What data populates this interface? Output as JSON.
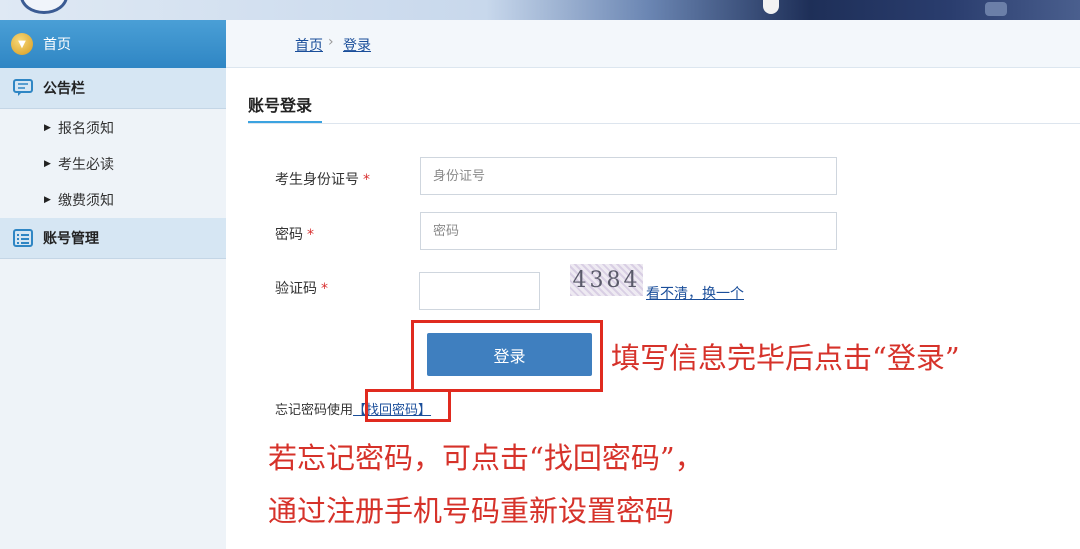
{
  "sidebar": {
    "home_label": "首页",
    "sections": [
      {
        "label": "公告栏",
        "icon": "chat-bubble-icon"
      },
      {
        "label": "账号管理",
        "icon": "list-icon"
      }
    ],
    "sub_items": [
      "报名须知",
      "考生必读",
      "缴费须知"
    ]
  },
  "breadcrumb": {
    "home": "首页",
    "separator": "›",
    "current": "登录"
  },
  "panel": {
    "title": "账号登录"
  },
  "form": {
    "id_label": "考生身份证号",
    "id_placeholder": "身份证号",
    "password_label": "密码",
    "password_placeholder": "密码",
    "captcha_label": "验证码",
    "captcha_value": "",
    "captcha_image_text": "4384",
    "captcha_refresh": "看不清，换一个",
    "required_mark": "*",
    "login_button": "登录",
    "forgot_prefix": "忘记密码使用",
    "forgot_link": "【找回密码】"
  },
  "annotations": {
    "login_hint": "填写信息完毕后点击“登录”",
    "forgot_hint_line1": "若忘记密码，可点击“找回密码”，",
    "forgot_hint_line2": "通过注册手机号码重新设置密码"
  },
  "colors": {
    "accent_blue": "#3f7fbf",
    "annotation_red": "#e02a1f",
    "link_blue": "#1a4e9a"
  }
}
